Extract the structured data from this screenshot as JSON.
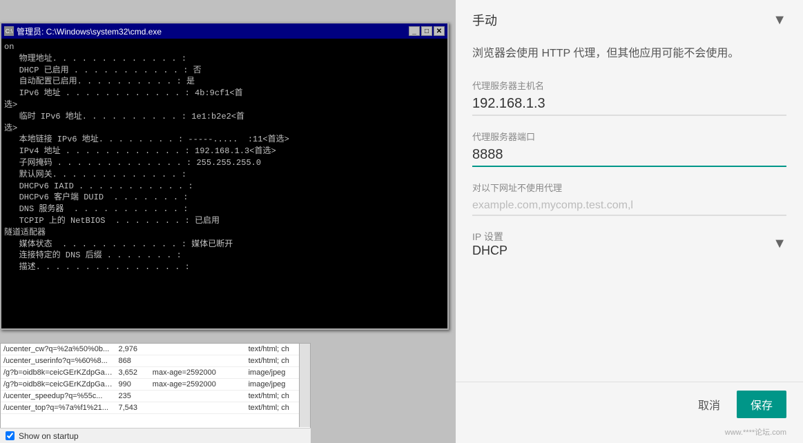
{
  "left": {
    "cmd": {
      "title": "管理员: C:\\Windows\\system32\\cmd.exe",
      "icon": "C:\\",
      "lines": [
        "on",
        "   物理地址. . . . . . . . . . . . . :",
        "   DHCP 已启用 . . . . . . . . . . . : 否",
        "   自动配置已启用. . . . . . . . . . : 是",
        "   IPv6 地址 . . . . . . . . . . . . : 4b:9cf1<首",
        "选>",
        "   临时 IPv6 地址. . . . . . . . . . : 1e1:b2e2<首",
        "选>",
        "   本地链接 IPv6 地址. . . . . . . . : -----.....  :11<首选>",
        "   IPv4 地址 . . . . . . . . . . . . : 192.168.1.3<首选>",
        "   子网掩码 . . . . . . . . . . . . . : 255.255.255.0",
        "   默认网关. . . . . . . . . . . . . :",
        "",
        "   DHCPv6 IAID . . . . . . . . . . . :",
        "   DHCPv6 客户端 DUID  . . . . . . . :",
        "",
        "   DNS 服务器  . . . . . . . . . . . :",
        "",
        "   TCPIP 上的 NetBIOS  . . . . . . . : 已启用",
        "",
        "隧道适配器",
        "",
        "   媒体状态  . . . . . . . . . . . . : 媒体已断开",
        "   连接特定的 DNS 后缀 . . . . . . . :",
        "   描述. . . . . . . . . . . . . . . :"
      ]
    },
    "network_log": {
      "rows": [
        {
          "url": "/ucenter_cw?q=%2a%50%0b...",
          "size": "2,976",
          "cache": "",
          "type": "text/html; ch"
        },
        {
          "url": "/ucenter_userinfo?q=%60%8...",
          "size": "868",
          "cache": "",
          "type": "text/html; ch"
        },
        {
          "url": "/g?b=oidb8k=ceicGErKZdpGaI...",
          "size": "3,652",
          "cache": "max-age=2592000",
          "type": "image/jpeg"
        },
        {
          "url": "/g?b=oidb8k=ceicGErKZdpGaI...",
          "size": "990",
          "cache": "max-age=2592000",
          "type": "image/jpeg"
        },
        {
          "url": "/ucenter_speedup?q=%55c...",
          "size": "235",
          "cache": "",
          "type": "text/html; ch"
        },
        {
          "url": "/ucenter_top?q=%7a%f1%21...",
          "size": "7,543",
          "cache": "",
          "type": "text/html; ch"
        }
      ],
      "show_startup_label": "Show on startup",
      "show_startup_checked": true
    }
  },
  "right": {
    "mode_label": "手动",
    "info_text": "浏览器会使用 HTTP 代理，但其他应用可能不会使用。",
    "proxy_host_label": "代理服务器主机名",
    "proxy_host_value": "192.168.1.3",
    "proxy_port_label": "代理服务器端口",
    "proxy_port_value": "8888",
    "no_proxy_label": "对以下网址不使用代理",
    "no_proxy_placeholder": "example.com,mycomp.test.com,l",
    "ip_settings_label": "IP 设置",
    "ip_settings_value": "DHCP",
    "cancel_label": "取消",
    "save_label": "保存",
    "watermark": "www.****论坛.com"
  }
}
